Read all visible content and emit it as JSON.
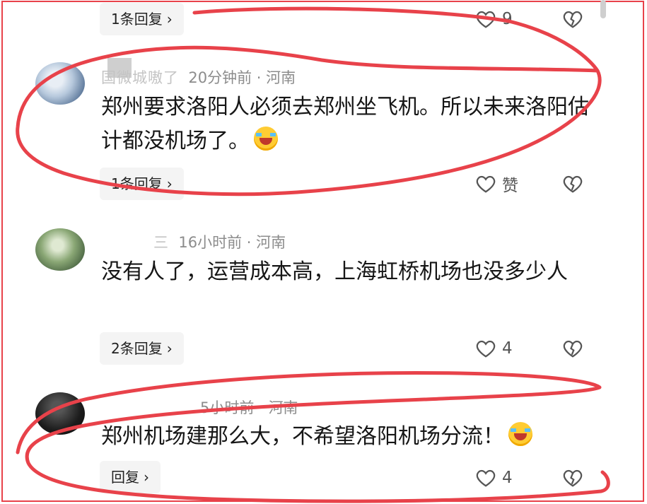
{
  "top_item": {
    "reply_label": "1条回复",
    "like_count": "9"
  },
  "comments": [
    {
      "username": "国微城嗷了",
      "time": "20分钟前",
      "sep": "·",
      "region": "河南",
      "text": "郑州要求洛阳人必须去郑州坐飞机。所以未来洛阳估计都没机场了。",
      "reply_label": "1条回复",
      "like_label": "赞"
    },
    {
      "username": "三",
      "time": "16小时前",
      "sep": "·",
      "region": "河南",
      "text": "没有人了，运营成本高，上海虹桥机场也没多少人",
      "reply_label": "2条回复",
      "like_label": "4"
    },
    {
      "username": "",
      "time": "5小时前",
      "sep": "·",
      "region": "河南",
      "text": "郑州机场建那么大，不希望洛阳机场分流！",
      "reply_label": "回复",
      "like_label": "4"
    }
  ],
  "icons": {
    "like": "heart-outline-icon",
    "dislike": "broken-heart-icon",
    "chevron": "chevron-right-icon",
    "emoji": "laughing-crying-emoji-icon"
  },
  "colors": {
    "annotation": "#e8424a",
    "meta": "#8c8c8c",
    "reply_bg": "#f4f4f4"
  }
}
